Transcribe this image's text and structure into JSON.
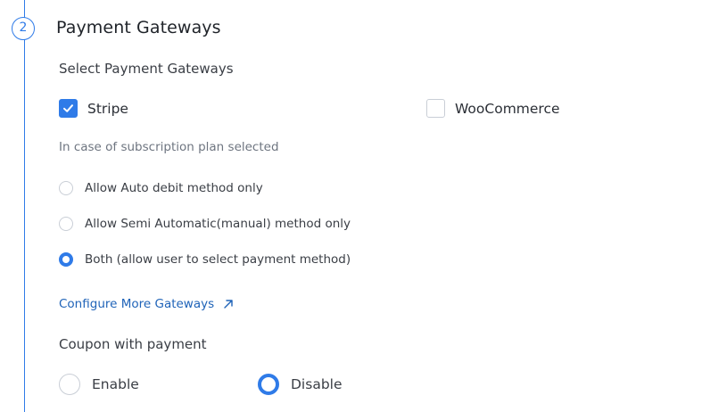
{
  "step": {
    "number": "2",
    "title": "Payment Gateways"
  },
  "gateways": {
    "heading": "Select Payment Gateways",
    "options": [
      {
        "label": "Stripe",
        "checked": true
      },
      {
        "label": "WooCommerce",
        "checked": false
      }
    ]
  },
  "subscription": {
    "hint": "In case of subscription plan selected",
    "options": [
      {
        "label": "Allow Auto debit method only",
        "selected": false
      },
      {
        "label": "Allow Semi Automatic(manual) method only",
        "selected": false
      },
      {
        "label": "Both (allow user to select payment method)",
        "selected": true
      }
    ]
  },
  "configure_link": {
    "label": "Configure More Gateways",
    "icon": "external-arrow-icon"
  },
  "coupon": {
    "heading": "Coupon with payment",
    "options": [
      {
        "label": "Enable",
        "selected": false
      },
      {
        "label": "Disable",
        "selected": true
      }
    ]
  },
  "colors": {
    "accent": "#2f7be8",
    "link": "#1f63b8",
    "border": "#c9ced6"
  }
}
